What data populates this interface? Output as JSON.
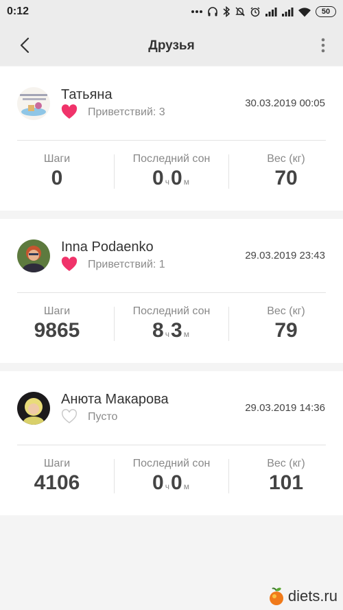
{
  "status_bar": {
    "time": "0:12",
    "battery": "50"
  },
  "header": {
    "title": "Друзья"
  },
  "labels": {
    "steps": "Шаги",
    "sleep": "Последний сон",
    "weight": "Вес (кг)",
    "hours_unit": "ч",
    "minutes_unit": "м"
  },
  "friends": [
    {
      "name": "Татьяна",
      "greetings": "Приветствий: 3",
      "liked": true,
      "timestamp": "30.03.2019 00:05",
      "steps": "0",
      "sleep_hours": "0",
      "sleep_minutes": "0",
      "weight": "70"
    },
    {
      "name": "Inna Podaenko",
      "greetings": "Приветствий: 1",
      "liked": true,
      "timestamp": "29.03.2019 23:43",
      "steps": "9865",
      "sleep_hours": "8",
      "sleep_minutes": "3",
      "weight": "79"
    },
    {
      "name": "Анюта Макарова",
      "greetings": "Пусто",
      "liked": false,
      "timestamp": "29.03.2019 14:36",
      "steps": "4106",
      "sleep_hours": "0",
      "sleep_minutes": "0",
      "weight": "101"
    }
  ],
  "colors": {
    "heart_active": "#f0336a",
    "heart_inactive": "#c9c9c9",
    "background": "#f4f4f4"
  },
  "watermark": {
    "text": "diets.ru"
  }
}
